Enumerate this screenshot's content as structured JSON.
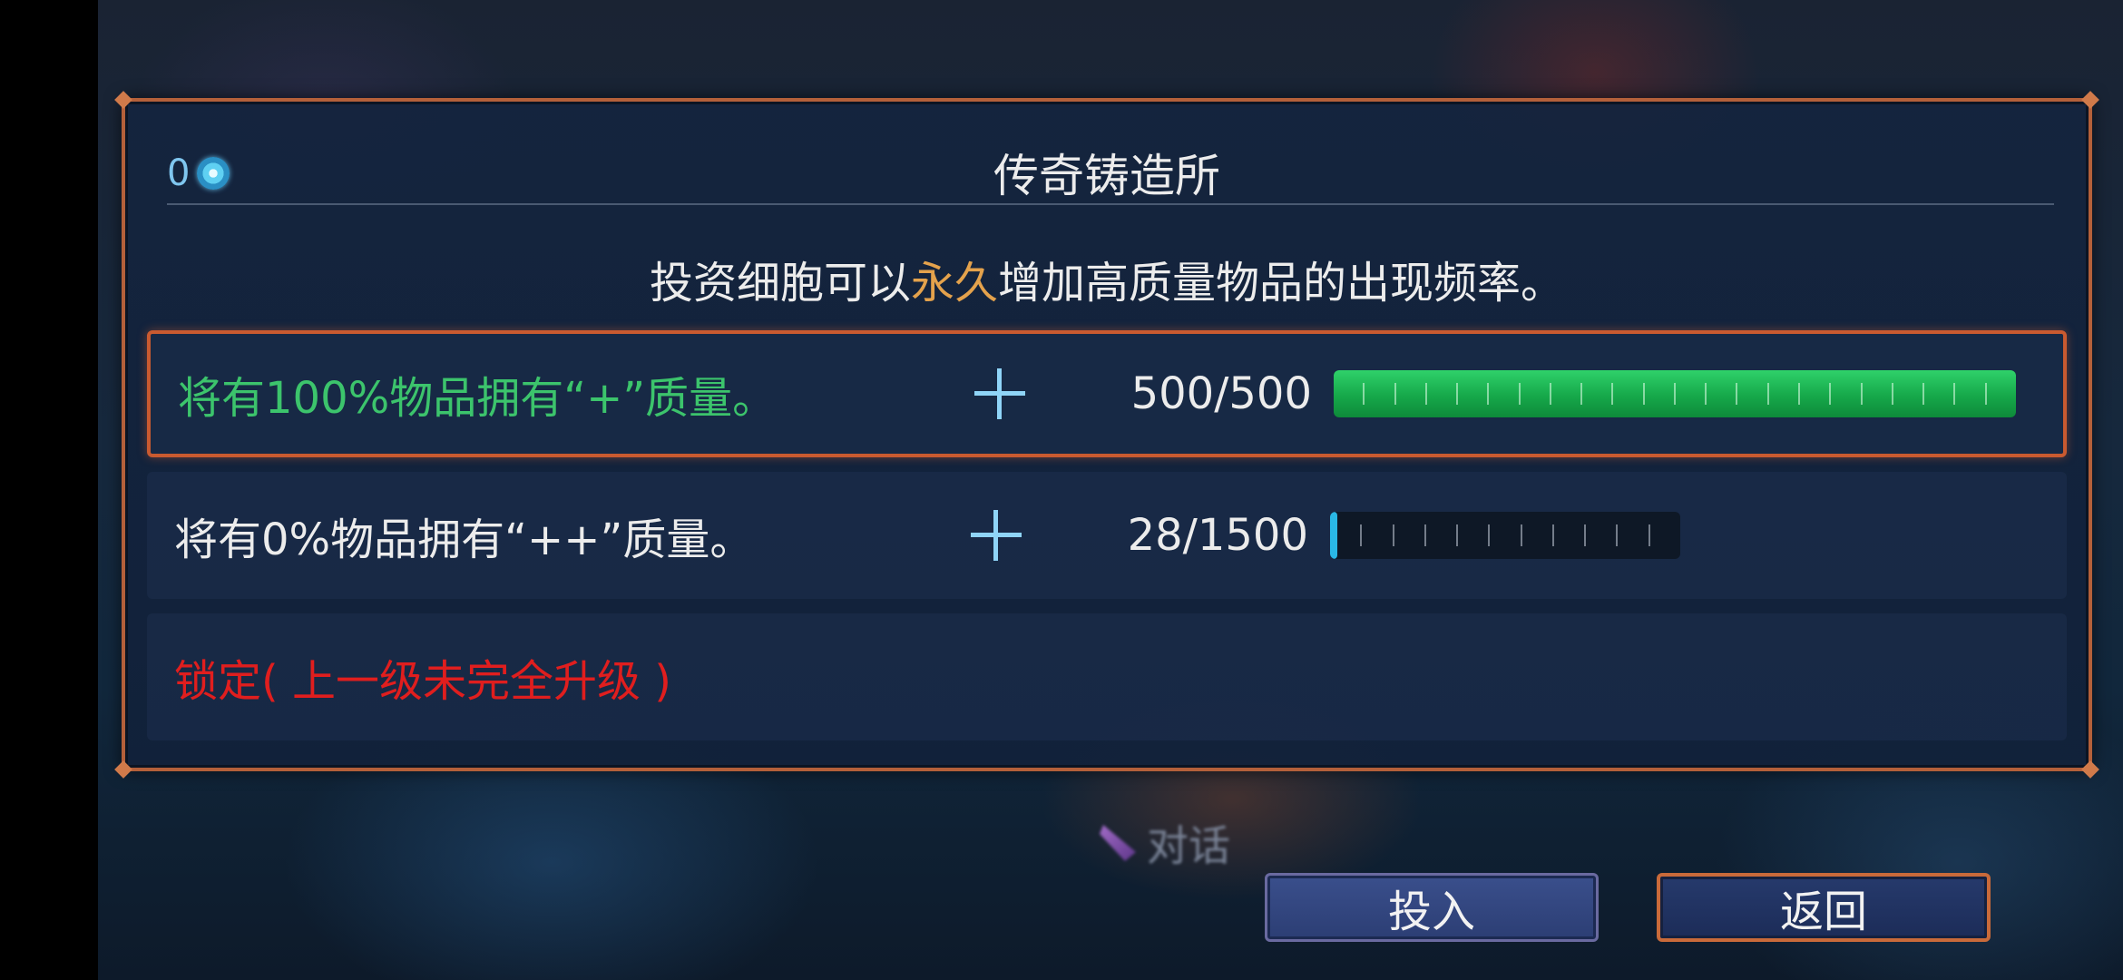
{
  "header": {
    "cell_count": "0",
    "cell_icon": "cell-currency-icon",
    "title": "传奇铸造所"
  },
  "description": {
    "before": "投资细胞可以",
    "highlight": "永久",
    "after": "增加高质量物品的出现频率。",
    "highlight_color": "#e4a24c"
  },
  "tiers": [
    {
      "label": "将有100%物品拥有“+”质量。",
      "label_color": "#3cc46c",
      "progress_text": "500/500",
      "progress_fraction": 1.0,
      "bar_color": "#1db954",
      "selected": true
    },
    {
      "label": "将有0%物品拥有“++”质量。",
      "label_color": "#ececec",
      "progress_text": "28/1500",
      "progress_fraction": 0.019,
      "bar_color": "#2ab8e6",
      "selected": false
    },
    {
      "label": "锁定( 上一级未完全升级 )",
      "label_color": "#e01e1e",
      "locked": true
    }
  ],
  "dialog_hint": {
    "icon": "quill-icon",
    "label": "对话"
  },
  "buttons": {
    "invest": "投入",
    "back": "返回"
  }
}
